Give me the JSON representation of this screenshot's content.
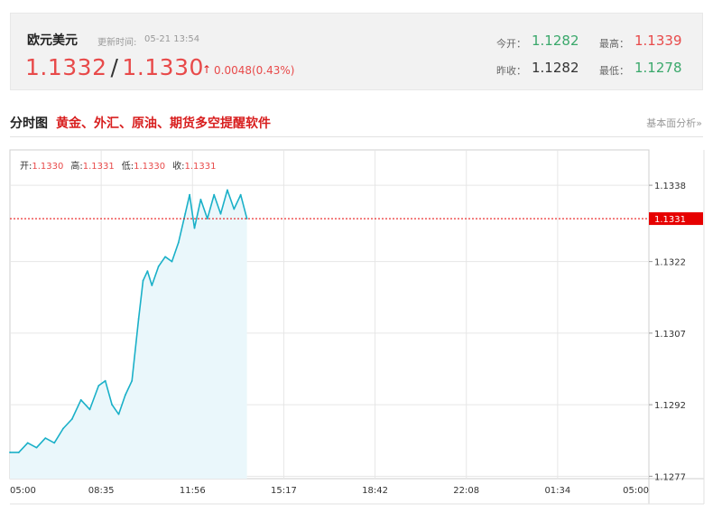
{
  "quote": {
    "name": "欧元美元",
    "time_label": "更新时间:",
    "time": "05-21 13:54",
    "price_bid": "1.1332",
    "price_ask": "1.1330",
    "change": "0.0048(0.43%)",
    "change_direction": "up",
    "open_label": "今开：",
    "open": "1.1282",
    "high_label": "最高：",
    "high": "1.1339",
    "prev_close_label": "昨收：",
    "prev_close": "1.1282",
    "low_label": "最低：",
    "low": "1.1278"
  },
  "section": {
    "title": "分时图",
    "promo": "黄金、外汇、原油、期货多空提醒软件",
    "link": "基本面分析»"
  },
  "ohlc_bar": {
    "open_label": "开:",
    "open": "1.1330",
    "high_label": "高:",
    "high": "1.1331",
    "low_label": "低:",
    "low": "1.1330",
    "close_label": "收:",
    "close": "1.1331"
  },
  "colors": {
    "line": "#1ab0c8",
    "area": "#eaf7fb",
    "up": "#e84a4a",
    "down": "#3aa86b",
    "current_marker": "#e60000"
  },
  "chart_data": {
    "type": "area",
    "title": "",
    "xlabel": "",
    "ylabel": "",
    "x_ticks": [
      "05:00",
      "08:35",
      "11:56",
      "15:17",
      "18:42",
      "22:08",
      "01:34",
      "05:00"
    ],
    "y_ticks": [
      1.1338,
      1.1322,
      1.1307,
      1.1292,
      1.1277
    ],
    "ylim": [
      1.12765,
      1.13454
    ],
    "current_value": 1.1331,
    "current_label": "1.1331",
    "grid": true,
    "series": [
      {
        "x": [
          "05:00",
          "05:20",
          "05:40",
          "06:00",
          "06:20",
          "06:40",
          "07:00",
          "07:20",
          "07:40",
          "08:00",
          "08:20",
          "08:35",
          "08:50",
          "09:05",
          "09:20",
          "09:35",
          "09:50",
          "10:00",
          "10:10",
          "10:20",
          "10:35",
          "10:50",
          "11:05",
          "11:20",
          "11:35",
          "11:45",
          "11:56",
          "12:10",
          "12:25",
          "12:40",
          "12:55",
          "13:10",
          "13:25",
          "13:40",
          "13:54"
        ],
        "values": [
          1.1282,
          1.1282,
          1.1284,
          1.1283,
          1.1285,
          1.1284,
          1.1287,
          1.1289,
          1.1293,
          1.1291,
          1.1296,
          1.1297,
          1.1292,
          1.129,
          1.1294,
          1.1297,
          1.131,
          1.1318,
          1.132,
          1.1317,
          1.1321,
          1.1323,
          1.1322,
          1.1326,
          1.1332,
          1.1336,
          1.1329,
          1.1335,
          1.1331,
          1.1336,
          1.1332,
          1.1337,
          1.1333,
          1.1336,
          1.1331
        ]
      }
    ]
  }
}
